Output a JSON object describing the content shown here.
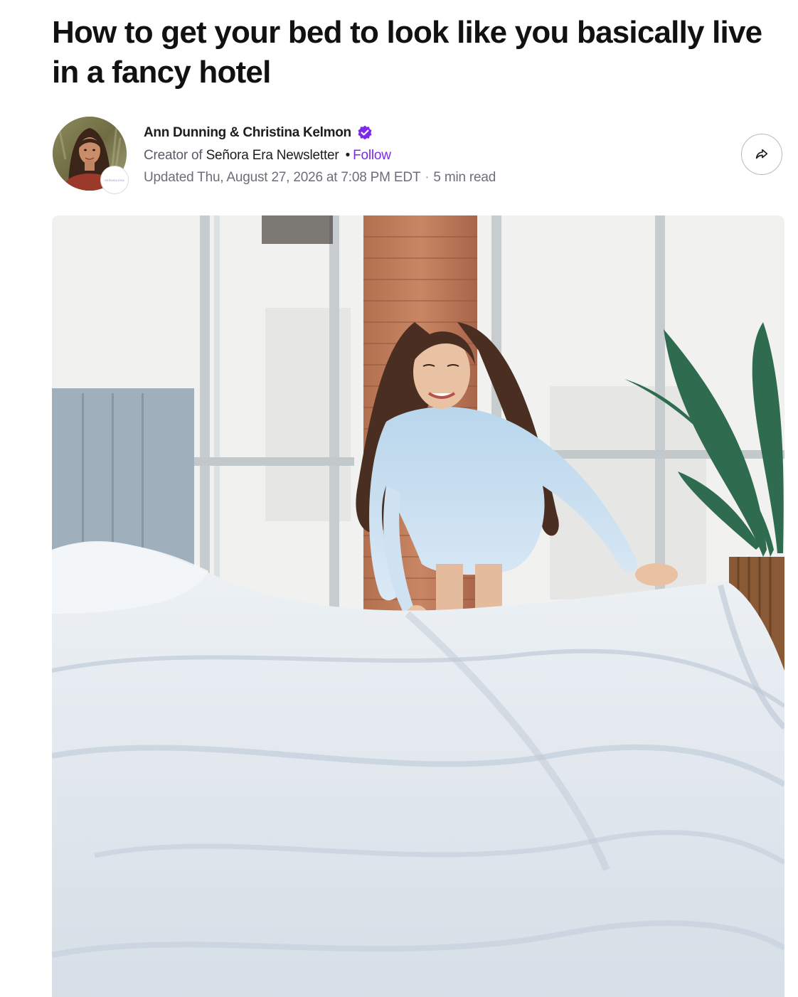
{
  "article": {
    "headline": "How to get your bed to look like you basically live in a fancy hotel"
  },
  "byline": {
    "author": "Ann Dunning & Christina Kelmon",
    "verified_icon": "verified-badge-icon",
    "creator_prefix": "Creator of",
    "publication": "Señora Era Newsletter",
    "separator": "•",
    "follow_label": "Follow",
    "updated": "Updated Thu, August 27, 2026 at 7:08 PM EDT",
    "meta_separator": "·",
    "read_time": "5 min read",
    "avatar_badge_text": "SEÑORA ERA"
  },
  "actions": {
    "share_icon": "share-arrow-icon"
  },
  "colors": {
    "accent": "#7d2ae8",
    "verified": "#7d2ae8",
    "text": "#1d1d1f",
    "muted": "#6e6e78"
  }
}
